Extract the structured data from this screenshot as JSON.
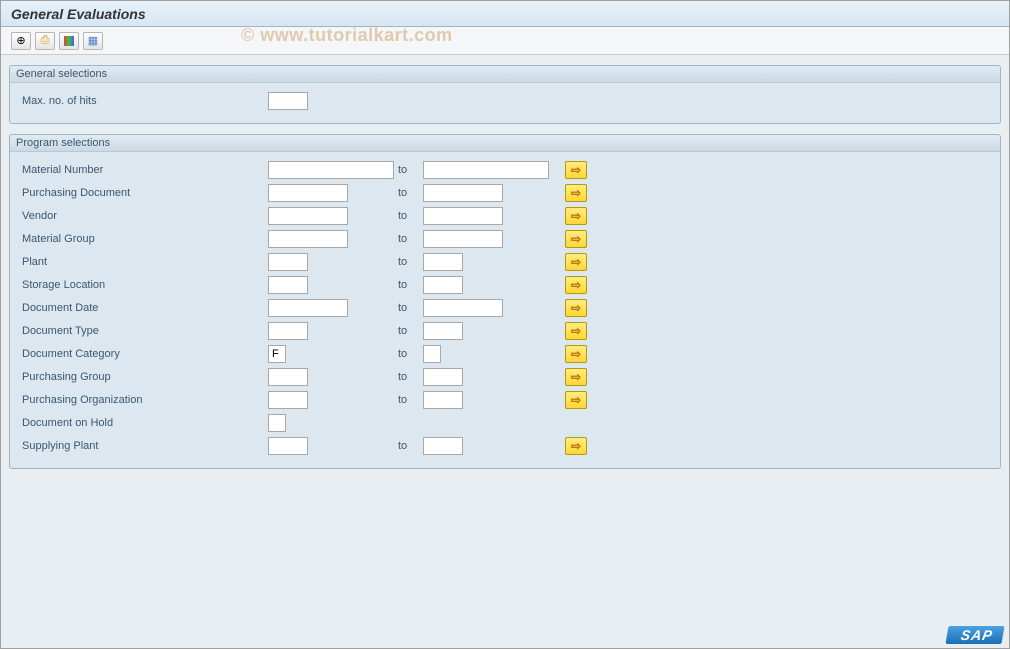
{
  "title": "General Evaluations",
  "watermark": "© www.tutorialkart.com",
  "sap_logo": "SAP",
  "sections": {
    "general": {
      "header": "General selections",
      "max_hits_label": "Max. no. of hits",
      "max_hits_value": ""
    },
    "program": {
      "header": "Program selections",
      "to_label": "to",
      "rows": {
        "material_number": {
          "label": "Material Number",
          "from": "",
          "to": ""
        },
        "purchasing_document": {
          "label": "Purchasing Document",
          "from": "",
          "to": ""
        },
        "vendor": {
          "label": "Vendor",
          "from": "",
          "to": ""
        },
        "material_group": {
          "label": "Material Group",
          "from": "",
          "to": ""
        },
        "plant": {
          "label": "Plant",
          "from": "",
          "to": ""
        },
        "storage_location": {
          "label": "Storage Location",
          "from": "",
          "to": ""
        },
        "document_date": {
          "label": "Document Date",
          "from": "",
          "to": ""
        },
        "document_type": {
          "label": "Document Type",
          "from": "",
          "to": ""
        },
        "document_category": {
          "label": "Document Category",
          "from": "F",
          "to": ""
        },
        "purchasing_group": {
          "label": "Purchasing Group",
          "from": "",
          "to": ""
        },
        "purchasing_organization": {
          "label": "Purchasing Organization",
          "from": "",
          "to": ""
        },
        "document_on_hold": {
          "label": "Document on Hold",
          "value": ""
        },
        "supplying_plant": {
          "label": "Supplying Plant",
          "from": "",
          "to": ""
        }
      }
    }
  }
}
